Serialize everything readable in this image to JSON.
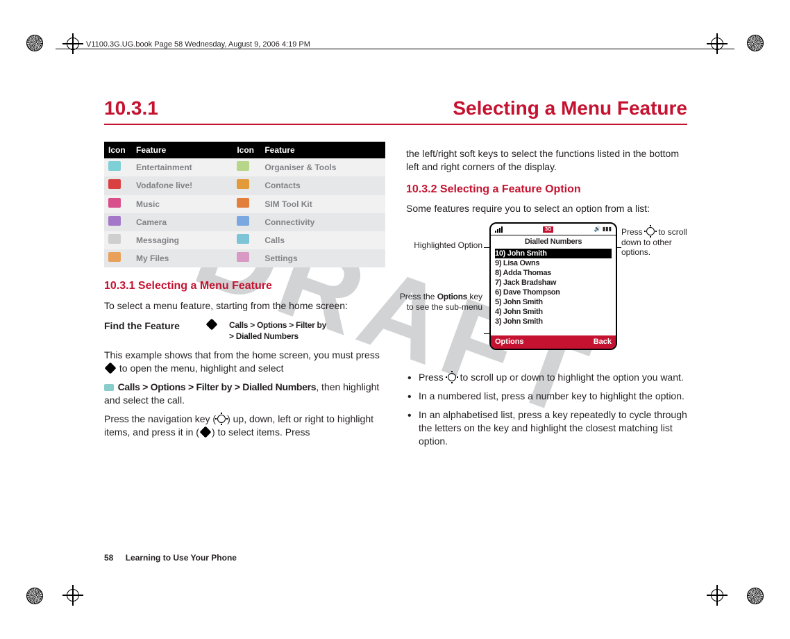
{
  "header": {
    "meta_line": "V1100.3G.UG.book  Page 58  Wednesday, August 9, 2006  4:19 PM"
  },
  "section": {
    "number": "10.3.1",
    "title": "Selecting a Menu Feature"
  },
  "watermark": "DRAFT",
  "feature_table": {
    "headers": [
      "Icon",
      "Feature",
      "Icon",
      "Feature"
    ],
    "rows": [
      {
        "left": "Entertainment",
        "right": "Organiser & Tools"
      },
      {
        "left": "Vodafone live!",
        "right": "Contacts"
      },
      {
        "left": "Music",
        "right": "SIM Tool Kit"
      },
      {
        "left": "Camera",
        "right": "Connectivity"
      },
      {
        "left": "Messaging",
        "right": "Calls"
      },
      {
        "left": "My Files",
        "right": "Settings"
      }
    ]
  },
  "left_col": {
    "h3": "10.3.1 Selecting a Menu Feature",
    "p1": "To select a menu feature, starting from the home screen:",
    "find_label": "Find the Feature",
    "find_path_l1": "Calls > Options > Filter by",
    "find_path_l2": "> Dialled Numbers",
    "p2a": "This example shows that from the home screen, you must press ",
    "p2b": " to open the menu, highlight and select",
    "p3": " Calls > Options > Filter by > Dialled Numbers",
    "p3b": ", then highlight and select the call.",
    "p4a": "Press the navigation key (",
    "p4b": ") up, down, left or right to highlight items, and press it in (",
    "p4c": ") to select items. Press"
  },
  "right_col": {
    "p1": "the left/right soft keys to select the functions listed in the bottom left and right corners of the display.",
    "h3": "10.3.2 Selecting a Feature Option",
    "p2": "Some features require you to select an option from a list:",
    "callout_left_top": "Highlighted Option",
    "callout_left_bot_a": "Press the ",
    "callout_left_bot_b": "Options",
    "callout_left_bot_c": " key to see the sub-menu",
    "callout_right_a": "Press ",
    "callout_right_b": " to scroll down to other options.",
    "phone": {
      "screen_title": "Dialled Numbers",
      "items": [
        "10) John Smith",
        "9) Lisa Owns",
        "8) Adda Thomas",
        "7) Jack Bradshaw",
        "6) Dave Thompson",
        "5) John Smith",
        "4) John Smith",
        "3) John Smith"
      ],
      "softkey_left": "Options",
      "softkey_right": "Back"
    },
    "bullets": [
      {
        "a": "Press ",
        "b": " to scroll up or down to highlight the option you want."
      },
      {
        "a": "In a numbered list, press a number key to highlight the option."
      },
      {
        "a": "In an alphabetised list, press a key repeatedly to cycle through the letters on the key and highlight the closest matching list option."
      }
    ]
  },
  "footer": {
    "page": "58",
    "chapter": "Learning to Use Your Phone"
  }
}
